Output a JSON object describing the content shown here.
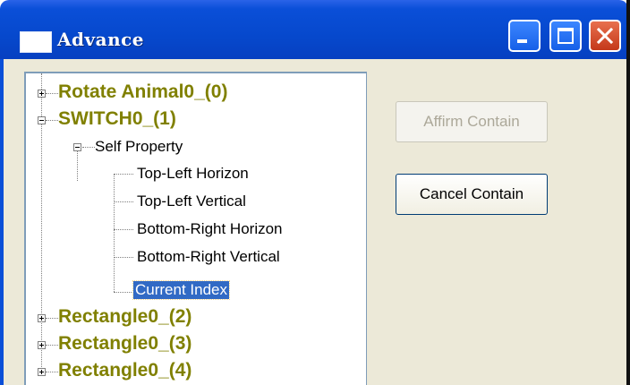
{
  "window": {
    "title": "Advance"
  },
  "titlebar_icons": [
    "minimize-icon",
    "maximize-icon",
    "close-icon"
  ],
  "tree": {
    "nodes": [
      {
        "label": "Rotate Animal0_(0)",
        "expander": "plus"
      },
      {
        "label": "SWITCH0_(1)",
        "expander": "minus"
      },
      {
        "label": "Self Property",
        "expander": "minus"
      },
      {
        "label": "Top-Left Horizon"
      },
      {
        "label": "Top-Left Vertical"
      },
      {
        "label": "Bottom-Right Horizon"
      },
      {
        "label": "Bottom-Right Vertical"
      },
      {
        "label": "Current Index",
        "selected": true
      },
      {
        "label": "Rectangle0_(2)",
        "expander": "plus"
      },
      {
        "label": "Rectangle0_(3)",
        "expander": "plus"
      },
      {
        "label": "Rectangle0_(4)",
        "expander": "plus"
      }
    ]
  },
  "buttons": {
    "affirm": {
      "label": "Affirm Contain",
      "enabled": false
    },
    "cancel": {
      "label": "Cancel Contain",
      "enabled": true
    }
  },
  "colors": {
    "titlebar": "#0648cc",
    "top_node": "#808000",
    "selection": "#316ac5"
  }
}
